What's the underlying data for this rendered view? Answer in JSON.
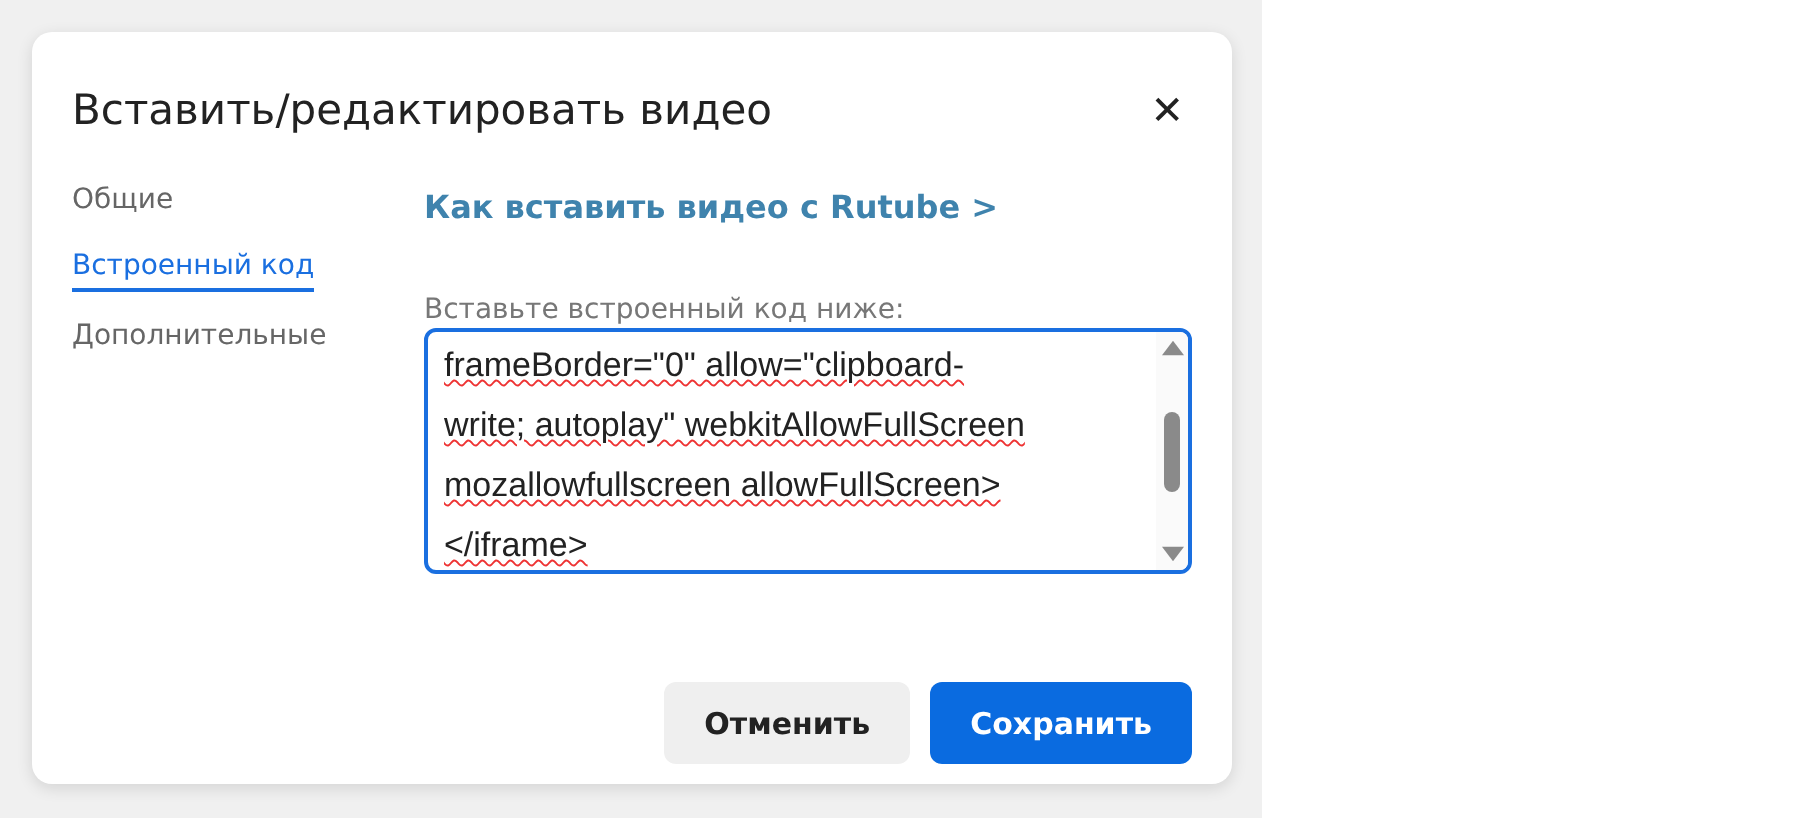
{
  "dialog": {
    "title": "Вставить/редактировать видео",
    "close": "✕"
  },
  "sidebar": {
    "items": [
      {
        "label": "Общие",
        "selected": false
      },
      {
        "label": "Встроенный код",
        "selected": true
      },
      {
        "label": "Дополнительные",
        "selected": false
      }
    ]
  },
  "help_link": "Как вставить видео с Rutube >",
  "embed_field": {
    "label": "Вставьте встроенный код ниже:",
    "value": "frameBorder=\"0\" allow=\"clipboard-\nwrite; autoplay\" webkitAllowFullScreen\nmozallowfullscreen allowFullScreen>\n</iframe>"
  },
  "buttons": [
    {
      "label": "Отменить",
      "kind": "secondary"
    },
    {
      "label": "Сохранить",
      "kind": "primary"
    }
  ]
}
